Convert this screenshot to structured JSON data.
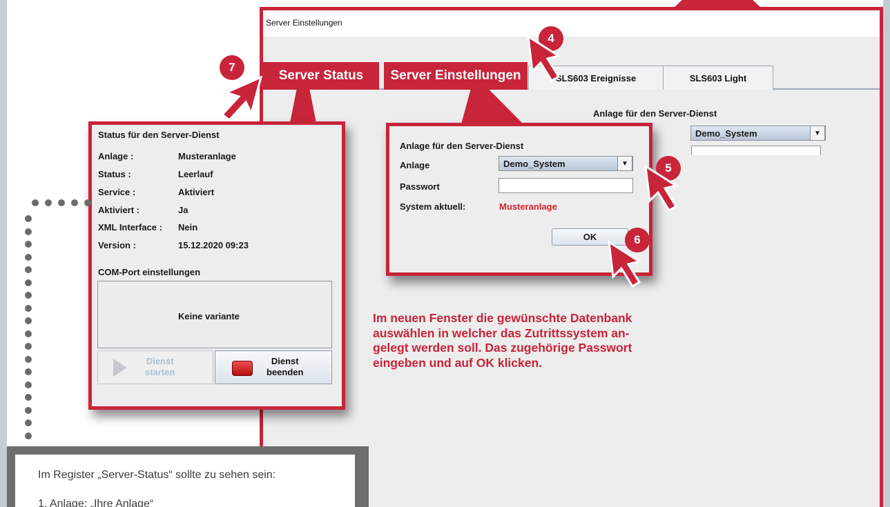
{
  "window": {
    "title": "Server Einstellungen"
  },
  "tabs": [
    {
      "label": "Server Status"
    },
    {
      "label": "Server Einstellungen"
    },
    {
      "label": "SLS603 Ereignisse"
    },
    {
      "label": "SLS603 Light"
    }
  ],
  "background_form": {
    "heading": "Anlage für den Server-Dienst",
    "combo_value": "Demo_System"
  },
  "status_panel": {
    "heading": "Status für den Server-Dienst",
    "rows": [
      {
        "label": "Anlage :",
        "value": "Musteranlage"
      },
      {
        "label": "Status :",
        "value": "Leerlauf"
      },
      {
        "label": "Service :",
        "value": "Aktiviert"
      },
      {
        "label": "Aktiviert :",
        "value": "Ja"
      },
      {
        "label": "XML Interface :",
        "value": "Nein"
      },
      {
        "label": "Version :",
        "value": "15.12.2020 09:23"
      }
    ],
    "com_heading": "COM-Port einstellungen",
    "variant_text": "Keine variante",
    "start_button": {
      "line1": "Dienst",
      "line2": "starten"
    },
    "stop_button": {
      "line1": "Dienst",
      "line2": "beenden"
    }
  },
  "dialog": {
    "heading": "Anlage für den Server-Dienst",
    "anlage_label": "Anlage",
    "anlage_value": "Demo_System",
    "password_label": "Passwort",
    "password_value": "",
    "system_label": "System aktuell:",
    "system_value": "Musteranlage",
    "ok_label": "OK"
  },
  "badges": [
    "4",
    "5",
    "6",
    "7"
  ],
  "instruction_text": "Im neuen Fenster die gewünschte Datenbank\nauswählen in welcher das Zutrittssystem an-\ngelegt werden soll. Das zugehörige Passwort\neingeben und auf OK klicken.",
  "bottom_panel": {
    "line1": "Im Register „Server-Status“ sollte zu sehen sein:",
    "line2": "1. Anlage: „Ihre Anlage“"
  },
  "colors": {
    "accent_red": "#c8243a",
    "value_red": "#d5202f",
    "panel_grey": "#ededed"
  }
}
